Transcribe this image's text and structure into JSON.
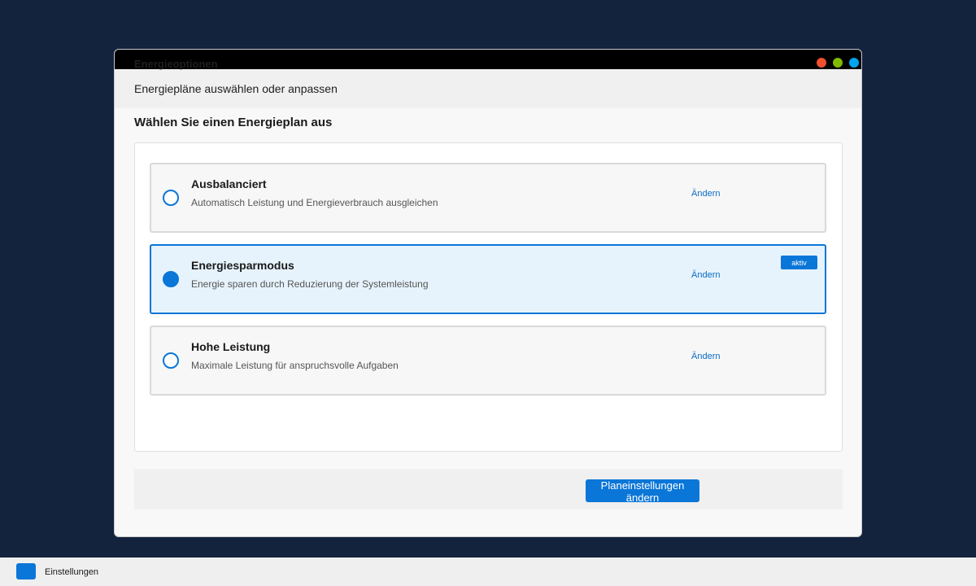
{
  "window": {
    "title": "Energieoptionen",
    "subheader": "Energiepläne auswählen oder anpassen",
    "section_title": "Wählen Sie einen Energieplan aus",
    "controls": {
      "close_color": "#f1502f",
      "minimize_color": "#7fba00",
      "maximize_color": "#00a4ef"
    }
  },
  "plans": [
    {
      "name": "Ausbalanciert",
      "description": "Automatisch Leistung und Energieverbrauch ausgleichen",
      "change_label": "Ändern",
      "selected": false
    },
    {
      "name": "Energiesparmodus",
      "description": "Energie sparen durch Reduzierung der Systemleistung",
      "change_label": "Ändern",
      "selected": true,
      "badge": "aktiv"
    },
    {
      "name": "Hohe Leistung",
      "description": "Maximale Leistung für anspruchsvolle Aufgaben",
      "change_label": "Ändern",
      "selected": false
    }
  ],
  "actions": {
    "primary_label": "Planeinstellungen ändern"
  },
  "taskbar": {
    "app_label": "Einstellungen"
  },
  "colors": {
    "accent": "#0a76d8",
    "desktop": "#13223d",
    "active_bg": "#e6f3fc"
  }
}
